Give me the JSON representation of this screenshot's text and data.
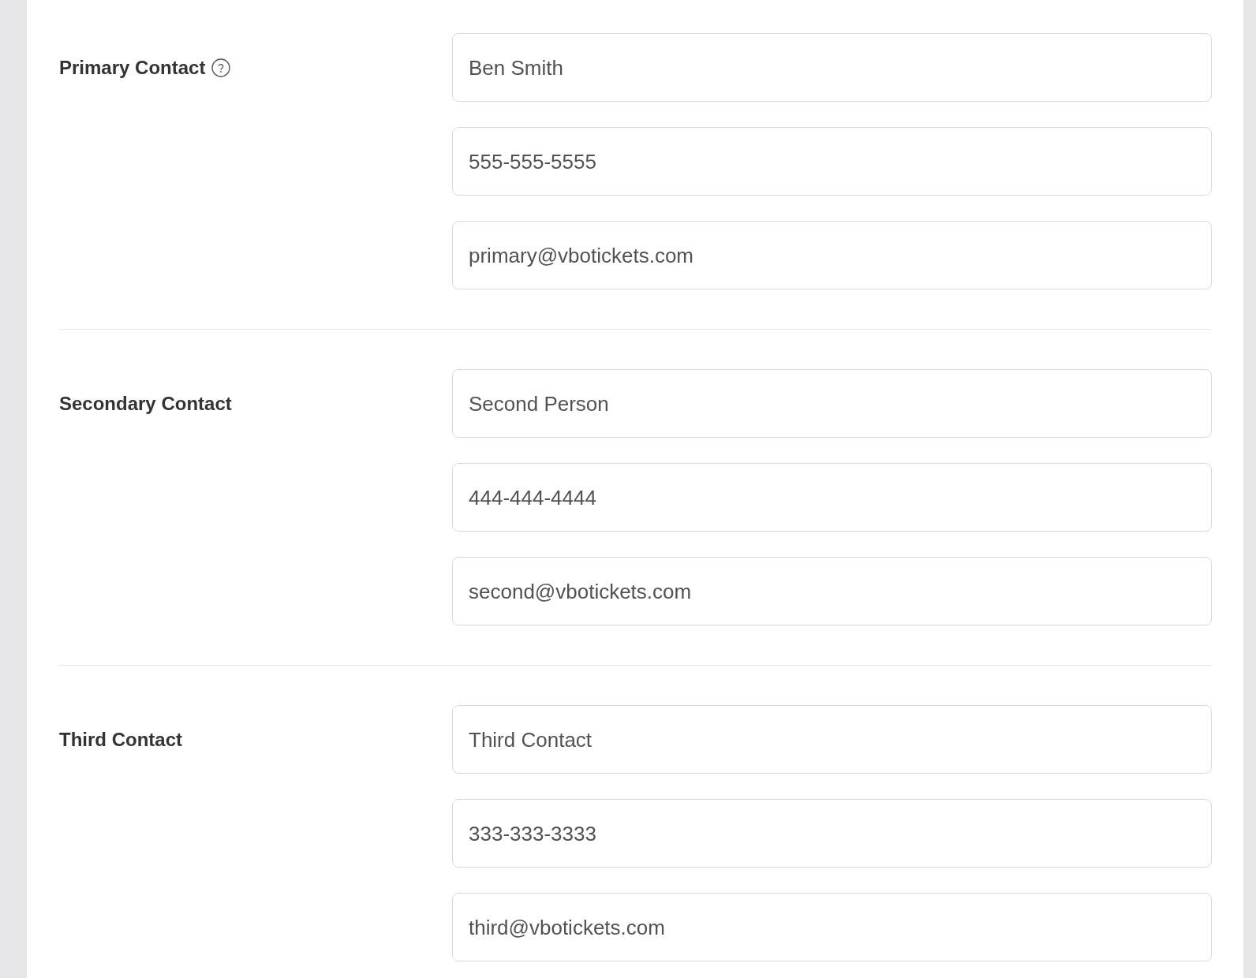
{
  "contacts": [
    {
      "label": "Primary Contact",
      "help_icon": true,
      "name": "Ben Smith",
      "phone": "555-555-5555",
      "email": "primary@vbotickets.com"
    },
    {
      "label": "Secondary Contact",
      "help_icon": false,
      "name": "Second Person",
      "phone": "444-444-4444",
      "email": "second@vbotickets.com"
    },
    {
      "label": "Third Contact",
      "help_icon": false,
      "name": "Third Contact",
      "phone": "333-333-3333",
      "email": "third@vbotickets.com"
    }
  ]
}
